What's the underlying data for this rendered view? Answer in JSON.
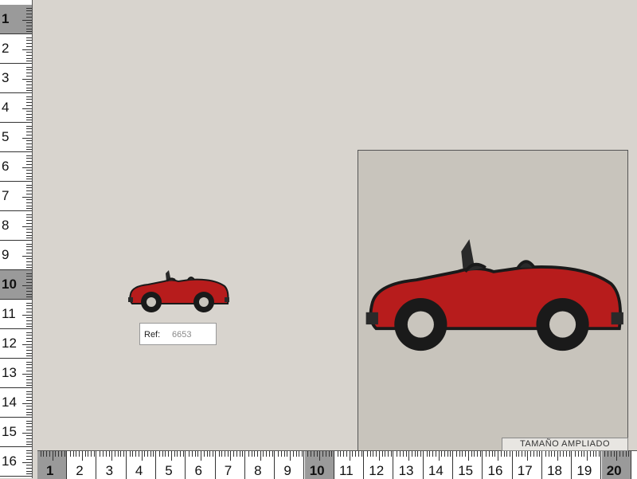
{
  "ruler": {
    "vertical": [
      "1",
      "2",
      "3",
      "4",
      "5",
      "6",
      "7",
      "8",
      "9",
      "10",
      "11",
      "12",
      "13",
      "14",
      "15",
      "16"
    ],
    "horizontal": [
      "1",
      "2",
      "3",
      "4",
      "5",
      "6",
      "7",
      "8",
      "9",
      "10",
      "11",
      "12",
      "13",
      "14",
      "15",
      "16",
      "17",
      "18",
      "19",
      "20"
    ],
    "highlighted": [
      "1",
      "10",
      "20"
    ]
  },
  "product": {
    "ref_label": "Ref:",
    "ref_value": "6653",
    "zoom_label": "TAMAÑO AMPLIADO",
    "patch_icon": "red-convertible-car-icon"
  },
  "colors": {
    "background": "#d8d4ce",
    "car_body": "#b71c1c",
    "outline": "#1a1a1a",
    "hubcap": "#c9c5bd",
    "ruler_highlight": "#9a9a9a"
  }
}
